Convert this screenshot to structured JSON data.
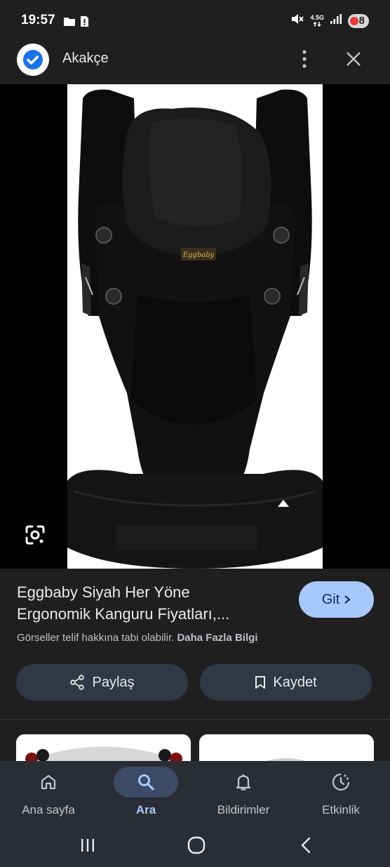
{
  "status_bar": {
    "time": "19:57",
    "network": "4.5G",
    "battery": "8",
    "icons": [
      "folder-icon",
      "sim-alert-icon",
      "mute-icon",
      "data-arrows-icon",
      "signal-icon",
      "battery-icon"
    ]
  },
  "app_bar": {
    "site_name": "Akakçe",
    "icons": [
      "verified-check-icon",
      "more-vert-icon",
      "close-icon"
    ]
  },
  "image": {
    "brand_tag": "Eggbaby",
    "lens_icon": "google-lens-icon"
  },
  "result": {
    "title_line1": "Eggbaby Siyah Her Yöne",
    "title_line2": "Ergonomik Kanguru Fiyatları,...",
    "visit_label": "Git",
    "copyright_text": "Görseller telif hakkına tabi olabilir.",
    "more_info_label": "Daha Fazla Bilgi",
    "share_label": "Paylaş",
    "save_label": "Kaydet"
  },
  "bottom_nav": {
    "items": [
      {
        "label": "Ana sayfa",
        "icon": "home-icon",
        "active": false
      },
      {
        "label": "Ara",
        "icon": "search-icon",
        "active": true
      },
      {
        "label": "Bildirimler",
        "icon": "bell-icon",
        "active": false
      },
      {
        "label": "Etkinlik",
        "icon": "activity-icon",
        "active": false
      }
    ]
  },
  "system_nav": {
    "icons": [
      "recents-icon",
      "home-pill-icon",
      "back-icon"
    ]
  },
  "colors": {
    "background": "#1f1f1f",
    "accent": "#a8c7fa",
    "button_bg": "#303846",
    "nav_bg": "#2a2d33",
    "nav_active_pill": "#3c4a66"
  }
}
